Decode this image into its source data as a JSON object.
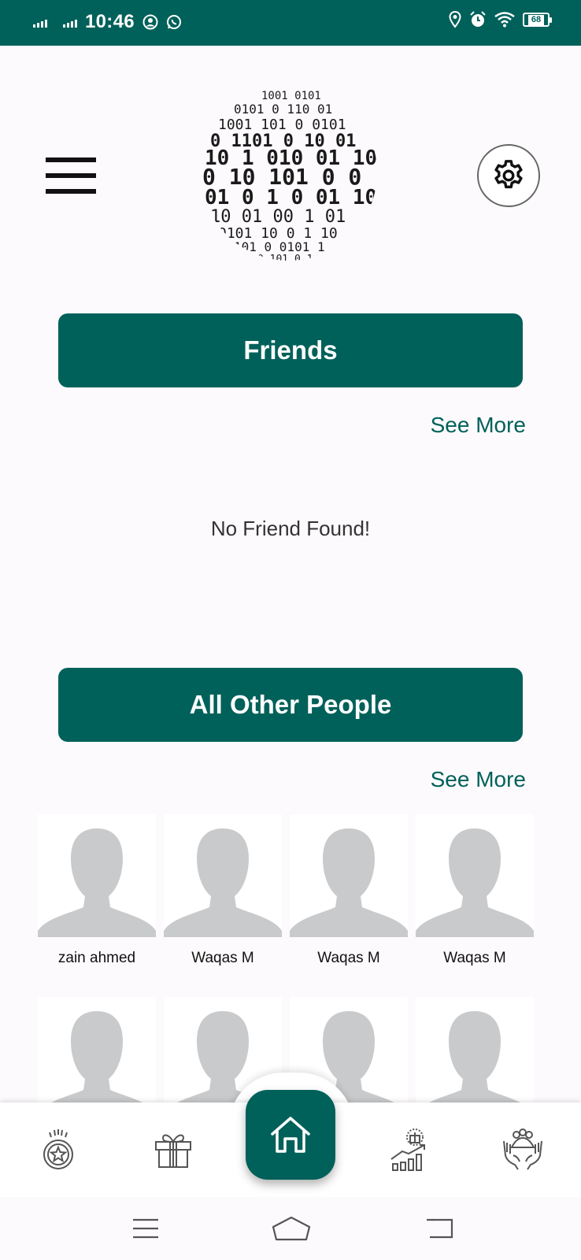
{
  "status_bar": {
    "time": "10:46",
    "battery": "68",
    "icons": [
      "signal-1-icon",
      "signal-2-icon",
      "account-icon",
      "whatsapp-icon",
      "location-icon",
      "alarm-icon",
      "wifi-icon",
      "battery-icon"
    ]
  },
  "header": {
    "menu_icon": "hamburger-icon",
    "logo_icon": "binary-sphere-logo",
    "settings_icon": "gear-icon"
  },
  "friends": {
    "title": "Friends",
    "see_more": "See More",
    "empty_message": "No Friend Found!"
  },
  "others": {
    "title": "All Other People",
    "see_more": "See More",
    "people": [
      {
        "name": "zain ahmed"
      },
      {
        "name": "Waqas M"
      },
      {
        "name": "Waqas M"
      },
      {
        "name": "Waqas M"
      },
      {
        "name": ""
      },
      {
        "name": ""
      },
      {
        "name": ""
      },
      {
        "name": ""
      }
    ]
  },
  "bottom_nav": {
    "items": [
      "badge-star-icon",
      "gift-icon",
      "home-icon",
      "gift-growth-chart-icon",
      "helping-hands-icon"
    ],
    "active": "home-icon"
  },
  "system_nav": [
    "recent-apps-icon",
    "home-outline-icon",
    "back-icon"
  ],
  "colors": {
    "primary": "#00615a",
    "background": "#fdfafd",
    "placeholder": "#c9cacc"
  }
}
